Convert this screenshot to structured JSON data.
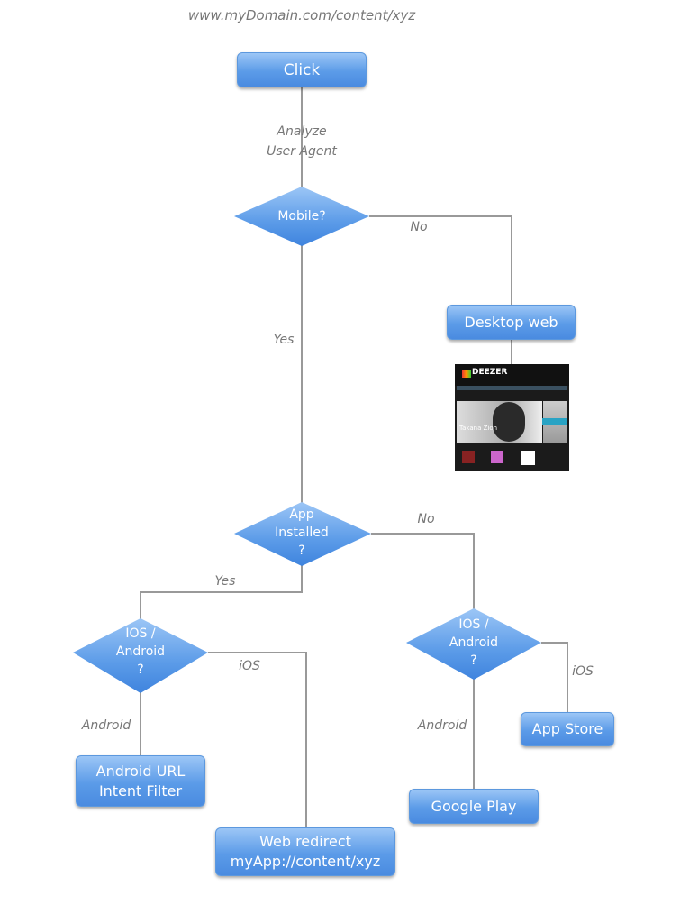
{
  "url_label": "www.myDomain.com/content/xyz",
  "nodes": {
    "click": "Click",
    "mobile": "Mobile?",
    "desktop_web": "Desktop web",
    "app_installed": "App\nInstalled\n?",
    "os_left": "IOS /\nAndroid\n?",
    "os_right": "IOS /\nAndroid\n?",
    "android_url": "Android URL\nIntent Filter",
    "web_redirect": "Web redirect\nmyApp://content/xyz",
    "app_store": "App Store",
    "google_play": "Google Play"
  },
  "edges": {
    "analyze": "Analyze\nUser Agent",
    "mobile_no": "No",
    "mobile_yes": "Yes",
    "installed_no": "No",
    "installed_yes": "Yes",
    "left_ios": "iOS",
    "left_android": "Android",
    "right_ios": "iOS",
    "right_android": "Android"
  },
  "thumbnail": {
    "brand": "DEEZER",
    "artist": "Takana Zion"
  },
  "colors": {
    "box_top": "#9cc6f6",
    "box_bottom": "#4a8be0",
    "line": "#999999",
    "label": "#777777"
  }
}
